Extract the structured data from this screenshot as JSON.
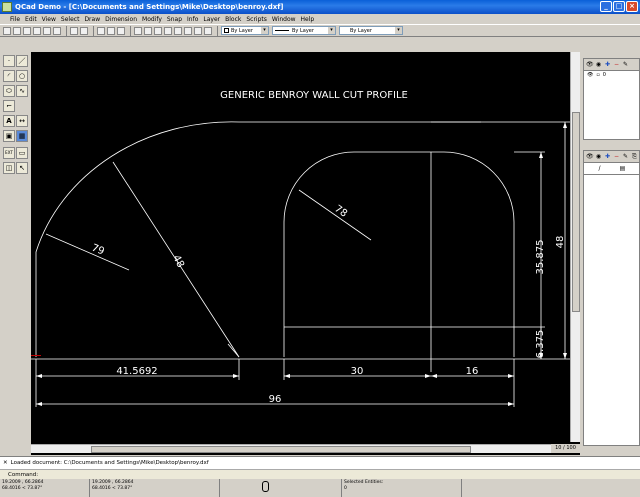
{
  "window": {
    "title": "QCad Demo - [C:\\Documents and Settings\\Mike\\Desktop\\benroy.dxf]"
  },
  "menu": [
    "File",
    "Edit",
    "View",
    "Select",
    "Draw",
    "Dimension",
    "Modify",
    "Snap",
    "Info",
    "Layer",
    "Block",
    "Scripts",
    "Window",
    "Help"
  ],
  "toolbar": {
    "color_combo": "By Layer",
    "width_combo": "By Layer",
    "linetype_combo": "By Layer"
  },
  "layer_panel": {
    "layer_name": "0"
  },
  "drawing": {
    "title": "GENERIC BENROY WALL CUT PROFILE",
    "dims": {
      "r79": "79",
      "r48_left": "48",
      "r78": "78",
      "d35875": "35.875",
      "d48_right": "48",
      "d6375": "6.375",
      "d415692": "41.5692",
      "d30": "30",
      "d16": "16",
      "d96": "96"
    }
  },
  "pager": "10 / 100",
  "command": {
    "history": "Loaded document: C:\\Documents and Settings\\Mike\\Desktop\\benroy.dxf",
    "prompt": "Command:"
  },
  "status": {
    "abs_coord": "19.2009 , 66.2864",
    "abs_polar": "68.4016 < 73.87°",
    "rel_coord": "19.2009 , 66.2864",
    "rel_polar": "68.4016 < 73.87°",
    "selected_label": "Selected Entities:",
    "selected_count": "0"
  }
}
